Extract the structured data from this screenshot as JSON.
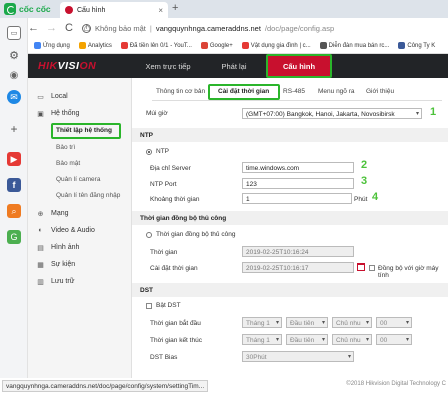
{
  "browser": {
    "brand": "cốc cốc",
    "tab_title": "Cấu hình",
    "tab_close": "×",
    "newtab": "+",
    "back": "←",
    "forward": "→",
    "reload": "C",
    "home": "⌂",
    "insecure": "Không bảo mật",
    "url_host": "vangquynhnga.cameraddns.net",
    "url_path": "/doc/page/config.asp",
    "bookmarks": [
      {
        "label": "Ứng dụng",
        "color": "#4285f4"
      },
      {
        "label": "Analytics",
        "color": "#f4a300"
      },
      {
        "label": "Đã tiền lên 0/1 - YouT...",
        "color": "#e53935"
      },
      {
        "label": "Google+",
        "color": "#db4437"
      },
      {
        "label": "Vật dụng gia đình | c...",
        "color": "#e53935"
      },
      {
        "label": "Diễn đàn mua bán rc...",
        "color": "#555555"
      },
      {
        "label": "Công Ty K",
        "color": "#3b5998"
      }
    ]
  },
  "app": {
    "logo_a": "HIK",
    "logo_b": "VISI",
    "logo_c": "ON",
    "menu": [
      "Xem trực tiếp",
      "Phát lại",
      "Cấu hình"
    ],
    "sidebar": {
      "local": "Local",
      "system": "Hệ thống",
      "system_sub": [
        "Thiết lập hệ thống",
        "Bảo trì",
        "Bảo mật",
        "Quản lí camera",
        "Quản lí tên đăng nhập"
      ],
      "network": "Mạng",
      "video": "Video & Audio",
      "image": "Hình ảnh",
      "event": "Sự kiện",
      "storage": "Lưu trữ"
    },
    "tabs": [
      "Thông tin cơ bản",
      "Cài đặt thời gian",
      "RS-485",
      "Menu ngõ ra",
      "Giới thiệu"
    ],
    "timezone_label": "Múi giờ",
    "timezone_value": "(GMT+07:00) Bangkok, Hanoi, Jakarta, Novosibirsk",
    "ntp": {
      "section": "NTP",
      "radio": "NTP",
      "server_label": "Địa chỉ Server",
      "server_value": "time.windows.com",
      "port_label": "NTP Port",
      "port_value": "123",
      "interval_label": "Khoảng thời gian",
      "interval_value": "1",
      "interval_unit": "Phút"
    },
    "manual": {
      "section": "Thời gian đồng bộ thủ công",
      "radio": "Thời gian đồng bộ thủ công",
      "time_label": "Thời gian",
      "time_value": "2019-02-25T10:16:24",
      "set_label": "Cài đặt thời gian",
      "set_value": "2019-02-25T10:16:17",
      "sync_label": "Đồng bộ với giờ máy tính"
    },
    "dst": {
      "section": "DST",
      "enable": "Bật DST",
      "start_label": "Thời gian bắt đầu",
      "end_label": "Thời gian kết thúc",
      "bias_label": "DST Bias",
      "month": "Tháng 1",
      "week": "Đầu tiên",
      "day": "Chủ nhu",
      "hour": "00",
      "bias_value": "30Phút"
    },
    "annotations": [
      "1",
      "2",
      "3",
      "4"
    ],
    "highlight_color": "#2bb52b"
  },
  "status": {
    "url": "vangquynhnga.cameraddns.net/doc/page/config/system/settingTim...",
    "copyright": "©2018 Hikvision Digital Technology C"
  }
}
